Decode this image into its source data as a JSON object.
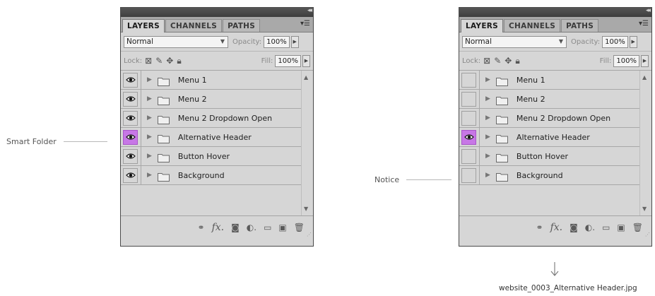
{
  "callouts": {
    "left": "Smart Folder",
    "right": "Notice"
  },
  "panel": {
    "tabs": [
      "LAYERS",
      "CHANNELS",
      "PATHS"
    ],
    "blend_mode": "Normal",
    "opacity_label": "Opacity:",
    "opacity_value": "100%",
    "lock_label": "Lock:",
    "fill_label": "Fill:",
    "fill_value": "100%"
  },
  "layers": [
    {
      "name": "Menu 1"
    },
    {
      "name": "Menu 2"
    },
    {
      "name": "Menu 2 Dropdown Open"
    },
    {
      "name": "Alternative Header"
    },
    {
      "name": "Button Hover"
    },
    {
      "name": "Background"
    }
  ],
  "left_panel_visibility": [
    true,
    true,
    true,
    true,
    true,
    true
  ],
  "right_panel_visibility": [
    false,
    false,
    false,
    true,
    false,
    false
  ],
  "highlight_index": 3,
  "highlight_color": "#c777e6",
  "output_filename": "website_0003_Alternative Header.jpg",
  "icons": {
    "visibility": "eye-icon",
    "expand": "triangle-right-icon",
    "group": "folder-icon",
    "footer": [
      "link-icon",
      "fx-icon",
      "mask-icon",
      "adjustment-icon",
      "new-group-icon",
      "new-layer-icon",
      "trash-icon"
    ]
  }
}
